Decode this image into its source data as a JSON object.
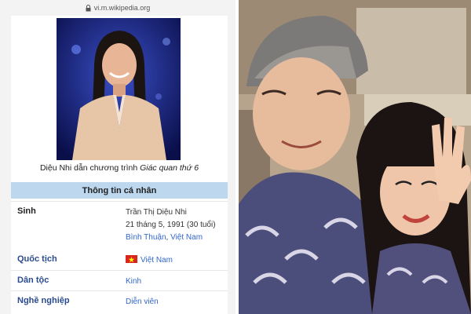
{
  "browser": {
    "url": "vi.m.wikipedia.org"
  },
  "infobox": {
    "caption_prefix": "Diệu Nhi dẫn chương trình ",
    "caption_show": "Giác quan thứ 6",
    "section_title": "Thông tin cá nhân",
    "rows": [
      {
        "label": "Sinh",
        "lines": [
          "Trần Thị Diệu Nhi",
          "21 tháng 5, 1991 (30 tuổi)"
        ],
        "place_1": "Bình Thuận",
        "place_sep": ", ",
        "place_2": "Việt Nam"
      },
      {
        "label": "Quốc tịch",
        "value": "Việt Nam",
        "flag": "vietnam-flag-icon"
      },
      {
        "label": "Dân tộc",
        "value": "Kinh"
      },
      {
        "label": "Nghề nghiệp",
        "value": "Diễn viên"
      }
    ]
  },
  "colors": {
    "link": "#3366cc",
    "header_bg": "#bcd7ee",
    "flag_red": "#da251d",
    "flag_star": "#ffff00"
  }
}
